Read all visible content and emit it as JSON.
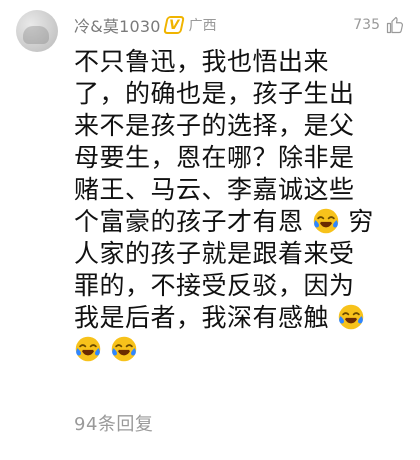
{
  "comment": {
    "username": "冷&莫1030",
    "region": "广西",
    "likes": "735",
    "lines": [
      "不只鲁迅，我也悟出来",
      "了，的确也是，孩子生出",
      "来不是孩子的选择，是父",
      "母要生，恩在哪？除非是",
      "赌王、马云、李嘉诚这些",
      "个富豪的孩子才有恩",
      "穷",
      "人家的孩子就是跟着来受",
      "罪的，不接受反驳，因为",
      "我是后者，我深有感触"
    ],
    "emojis": {
      "laugh_cry": "laugh-cry-emoji"
    },
    "replies_label": "94条回复"
  },
  "icons": {
    "vip_badge": "vip-badge-icon",
    "like": "thumb-up-icon",
    "avatar": "avatar"
  },
  "colors": {
    "username": "#7a7a7a",
    "muted": "#9a9a9a",
    "text": "#111111",
    "vip": "#f0b400",
    "emoji_face": "#f7c21b",
    "emoji_tear": "#2f86ff"
  }
}
